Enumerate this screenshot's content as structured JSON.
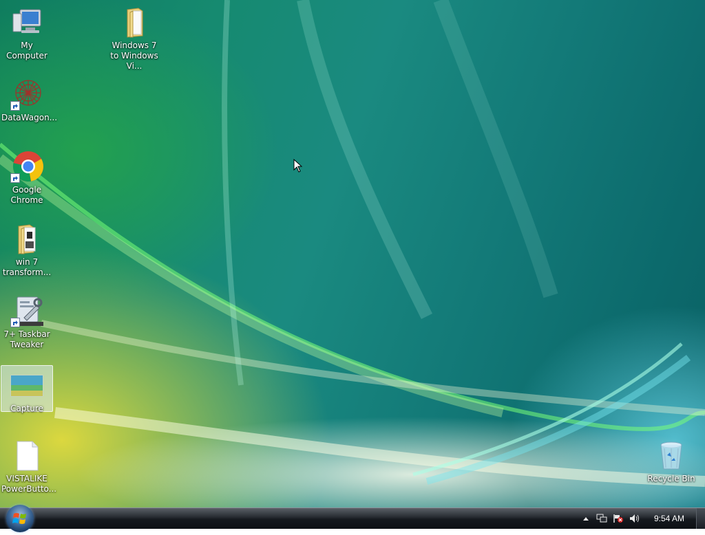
{
  "desktop": {
    "icons": [
      {
        "label": "My Computer"
      },
      {
        "label": "Windows 7 to Windows Vi..."
      },
      {
        "label": "DataWagon..."
      },
      {
        "label": "Google Chrome"
      },
      {
        "label": "win 7 transform..."
      },
      {
        "label": "7+ Taskbar Tweaker"
      },
      {
        "label": "Capture"
      },
      {
        "label": "VISTALIKE PowerButto..."
      },
      {
        "label": "Recycle Bin"
      }
    ]
  },
  "taskbar": {
    "start_icon": "windows-orb-icon",
    "tray": {
      "icons": [
        "show-hidden-icons-arrow",
        "network-icon",
        "action-center-flag-icon",
        "volume-icon"
      ],
      "clock": "9:54 AM"
    }
  },
  "colors": {
    "accent_teal": "#137a78",
    "accent_green": "#2aa84a",
    "accent_yellow": "#e6dc3c",
    "taskbar": "#15191e"
  }
}
